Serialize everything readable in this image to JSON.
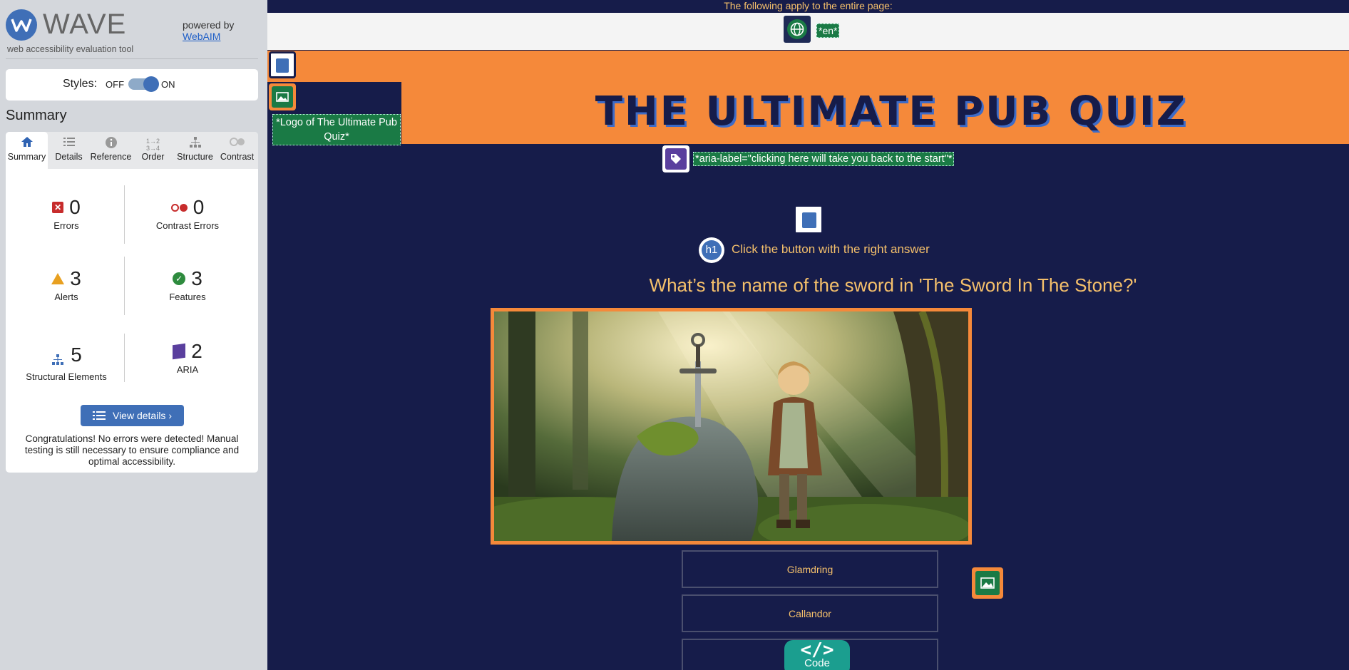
{
  "wave": {
    "brand": "WAVE",
    "tagline": "web accessibility evaluation tool",
    "powered_by": "powered by",
    "webaim_link": "WebAIM",
    "styles_label": "Styles:",
    "styles_off": "OFF",
    "styles_on": "ON",
    "summary_title": "Summary",
    "tabs": [
      {
        "label": "Summary",
        "icon": "home-icon",
        "active": true
      },
      {
        "label": "Details",
        "icon": "list-icon"
      },
      {
        "label": "Reference",
        "icon": "info-icon"
      },
      {
        "label": "Order",
        "icon": "order-icon"
      },
      {
        "label": "Structure",
        "icon": "structure-icon"
      },
      {
        "label": "Contrast",
        "icon": "contrast-icon"
      }
    ],
    "stats": {
      "errors": {
        "value": "0",
        "label": "Errors"
      },
      "contrast_errors": {
        "value": "0",
        "label": "Contrast Errors"
      },
      "alerts": {
        "value": "3",
        "label": "Alerts"
      },
      "features": {
        "value": "3",
        "label": "Features"
      },
      "structural": {
        "value": "5",
        "label": "Structural Elements"
      },
      "aria": {
        "value": "2",
        "label": "ARIA"
      }
    },
    "view_details": "View details ›",
    "congrats": "Congratulations! No errors were detected! Manual testing is still necessary to ensure compliance and optimal accessibility.",
    "colors": {
      "accent": "#3f6fb7",
      "error": "#c72c2c",
      "alert": "#e8a020",
      "feature": "#2e8b3e",
      "aria": "#5a3f9e"
    }
  },
  "page": {
    "apply_text": "The following apply to the entire page:",
    "lang_label": "*en*",
    "site_title": "THE ULTIMATE PUB QUIZ",
    "logo_alt_label": "*Logo of The Ultimate Pub Quiz*",
    "aria_label_text": "*aria-label=\"clicking here will take you back to the start\"*",
    "h1_badge": "h1",
    "h1_text": "Click the button with the right answer",
    "question": "What’s the name of the sword in 'The Sword In The Stone?'",
    "answers": [
      "Glamdring",
      "Callandor"
    ],
    "code_button": "Code",
    "colors": {
      "background": "#161c4a",
      "header": "#f5893a",
      "text": "#f5c06b",
      "wave_green": "#1a7a45"
    }
  }
}
